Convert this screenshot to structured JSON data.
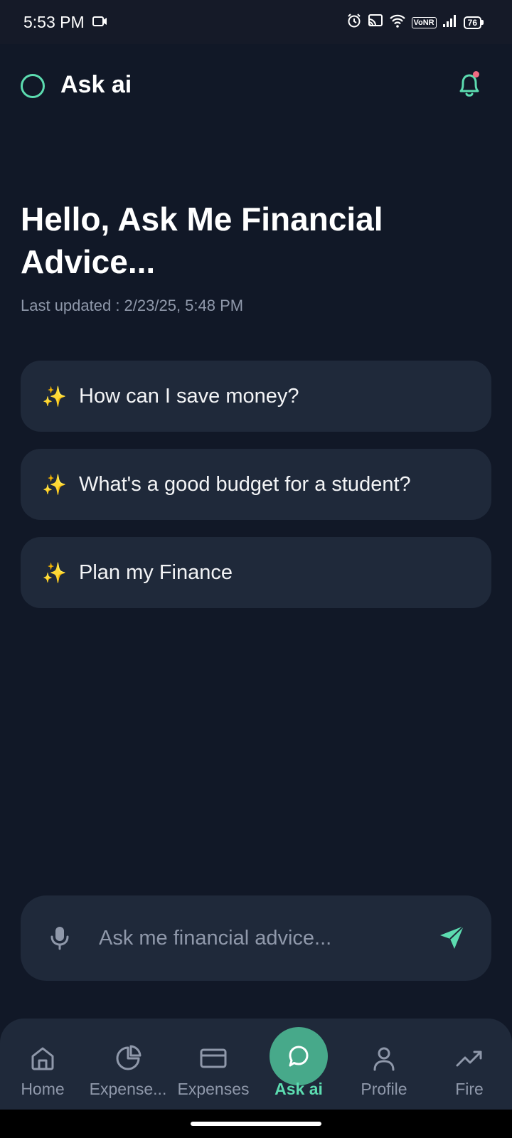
{
  "status_bar": {
    "time": "5:53 PM",
    "network": "VoNR",
    "battery": "76"
  },
  "header": {
    "title": "Ask ai"
  },
  "hero": {
    "title": "Hello, Ask Me Financial Advice...",
    "last_updated": "Last updated : 2/23/25, 5:48 PM"
  },
  "suggestions": [
    {
      "icon": "✨",
      "text": "How can I save money?"
    },
    {
      "icon": "✨",
      "text": "What's a good budget for a student?"
    },
    {
      "icon": "✨",
      "text": "Plan my Finance"
    }
  ],
  "input": {
    "placeholder": "Ask me financial advice...",
    "value": ""
  },
  "nav": {
    "items": [
      {
        "label": "Home",
        "icon": "home-icon"
      },
      {
        "label": "Expense...",
        "icon": "pie-chart-icon"
      },
      {
        "label": "Expenses",
        "icon": "credit-card-icon"
      },
      {
        "label": "Ask ai",
        "icon": "chat-icon",
        "active": true
      },
      {
        "label": "Profile",
        "icon": "user-icon"
      },
      {
        "label": "Fire",
        "icon": "trending-up-icon"
      }
    ]
  },
  "colors": {
    "background": "#111827",
    "card": "#1f293a",
    "accent": "#5cdcb0",
    "active_bubble": "#47a98a",
    "notification_dot": "#f06b82"
  }
}
